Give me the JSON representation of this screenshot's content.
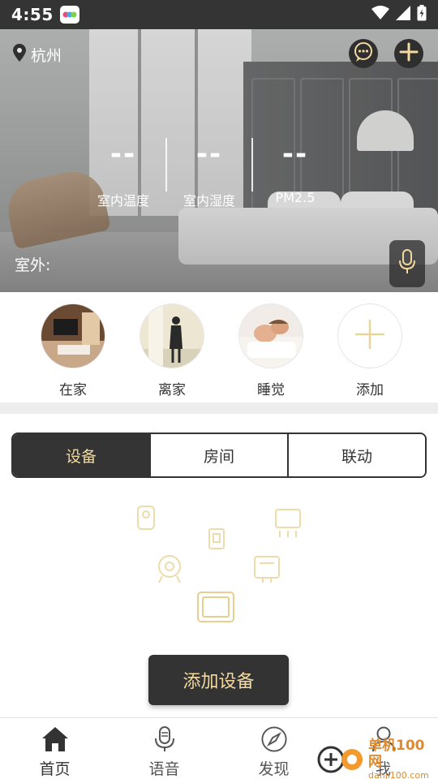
{
  "status_bar": {
    "time": "4:55"
  },
  "header": {
    "city": "杭州",
    "indoor_temp_value": "--",
    "indoor_temp_label": "室内温度",
    "indoor_humidity_value": "--",
    "indoor_humidity_label": "室内湿度",
    "pm25_value": "--",
    "pm25_label": "PM2.5",
    "outdoor_label": "室外:"
  },
  "scenes": [
    {
      "label": "在家"
    },
    {
      "label": "离家"
    },
    {
      "label": "睡觉"
    },
    {
      "label": "添加"
    }
  ],
  "tabs": [
    {
      "label": "设备",
      "active": true
    },
    {
      "label": "房间",
      "active": false
    },
    {
      "label": "联动",
      "active": false
    }
  ],
  "add_device_label": "添加设备",
  "bottom_nav": [
    {
      "label": "首页",
      "icon": "home-icon"
    },
    {
      "label": "语音",
      "icon": "microphone-icon"
    },
    {
      "label": "发现",
      "icon": "compass-icon"
    },
    {
      "label": "我",
      "icon": "user-icon"
    }
  ],
  "watermark": {
    "line1": "单机100网",
    "line2": "danji100.com"
  },
  "colors": {
    "accent": "#f2d9a0",
    "dark": "#343434"
  }
}
